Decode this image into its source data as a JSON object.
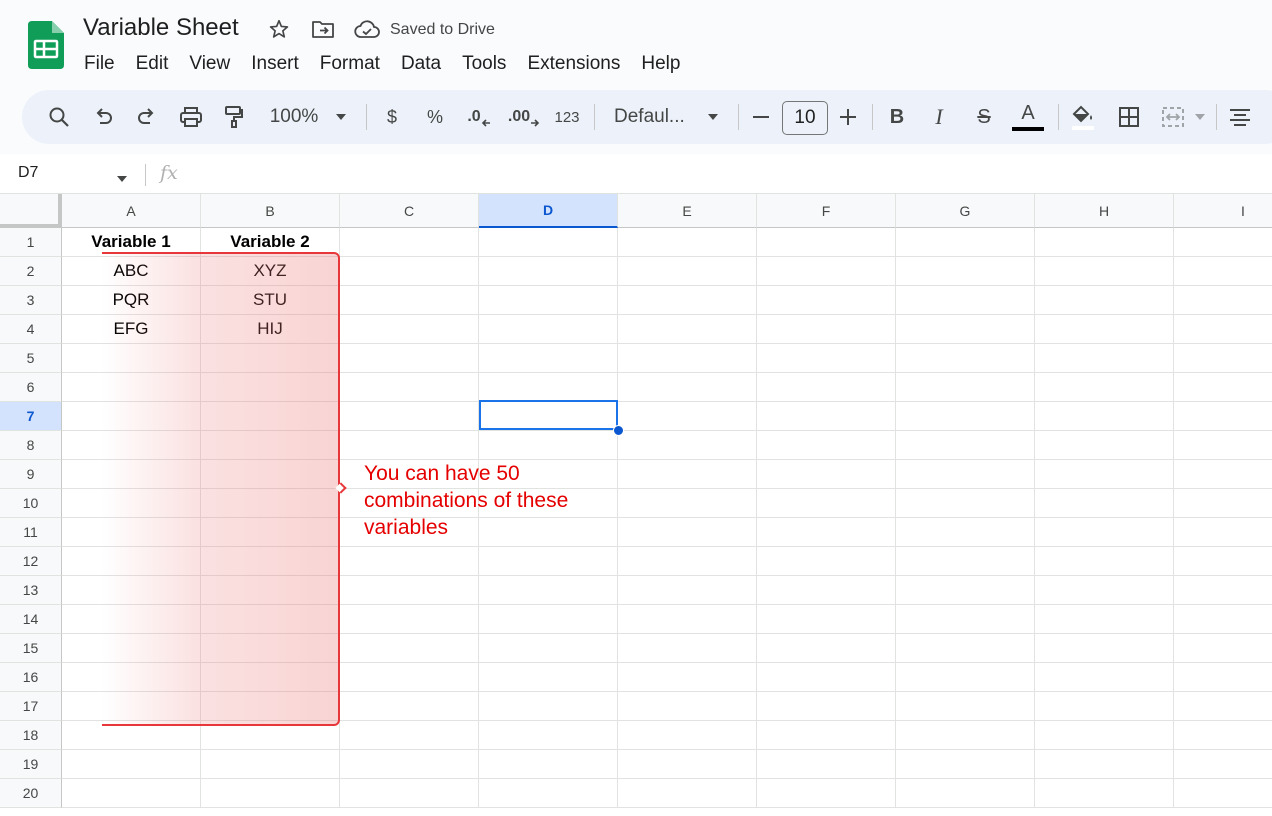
{
  "header": {
    "doc_title": "Variable Sheet",
    "save_status": "Saved to Drive"
  },
  "menu": [
    "File",
    "Edit",
    "View",
    "Insert",
    "Format",
    "Data",
    "Tools",
    "Extensions",
    "Help"
  ],
  "toolbar": {
    "zoom": "100%",
    "currency": "$",
    "percent": "%",
    "decrease_decimal": ".0",
    "increase_decimal": ".00",
    "number_format": "123",
    "font": "Defaul...",
    "font_size": "10",
    "text_color_glyph": "A",
    "text_color": "#000000",
    "bold_glyph": "B",
    "italic_glyph": "I",
    "strike_glyph": "S"
  },
  "formula_bar": {
    "name_box": "D7",
    "fx_label": "fx"
  },
  "grid": {
    "columns": [
      "A",
      "B",
      "C",
      "D",
      "E",
      "F",
      "G",
      "H",
      "I"
    ],
    "active_column": "D",
    "rows": [
      "1",
      "2",
      "3",
      "4",
      "5",
      "6",
      "7",
      "8",
      "9",
      "10",
      "11",
      "12",
      "13",
      "14",
      "15",
      "16",
      "17",
      "18",
      "19",
      "20"
    ],
    "active_row": "7",
    "cells": {
      "A1": "Variable 1",
      "B1": "Variable 2",
      "A2": "ABC",
      "B2": "XYZ",
      "A3": "PQR",
      "B3": "STU",
      "A4": "EFG",
      "B4": "HIJ"
    }
  },
  "annotation": {
    "text": "You can have 50 combinations of these variables",
    "color": "#e50000"
  },
  "colors": {
    "accent": "#0b57d0",
    "sheets_green": "#0f9d58",
    "highlight_border": "#e8373a"
  }
}
